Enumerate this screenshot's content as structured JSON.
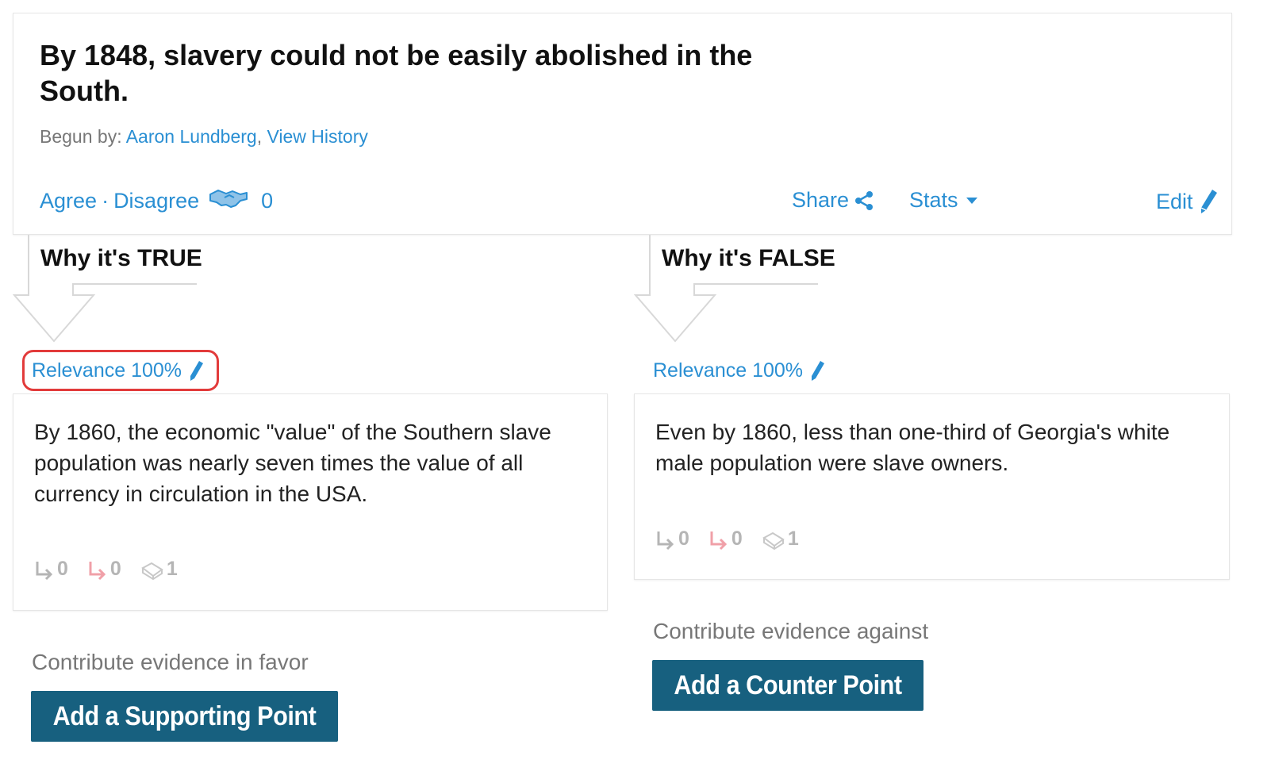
{
  "claim": {
    "title": "By 1848, slavery could not be easily abolished in the South.",
    "begun_by_label": "Begun by:",
    "author": "Aaron Lundberg",
    "separator": ",",
    "view_history": "View History",
    "agree": "Agree",
    "dot": "·",
    "disagree": "Disagree",
    "agree_count": "0",
    "share": "Share",
    "stats": "Stats",
    "edit": "Edit"
  },
  "columns": {
    "true": {
      "heading": "Why it's TRUE",
      "relevance": "Relevance 100%",
      "point_text": "By 1860, the economic \"value\" of the Southern slave population was nearly seven times the value of all currency in circulation in the USA.",
      "supporting_count": "0",
      "counter_count": "0",
      "sources_count": "1",
      "contribute": "Contribute evidence in favor",
      "button": "Add a Supporting Point"
    },
    "false": {
      "heading": "Why it's FALSE",
      "relevance": "Relevance 100%",
      "point_text": "Even by 1860, less than one-third of Georgia's white male population were slave owners.",
      "supporting_count": "0",
      "counter_count": "0",
      "sources_count": "1",
      "contribute": "Contribute evidence against",
      "button": "Add a Counter Point"
    }
  },
  "colors": {
    "link": "#2a8fd3",
    "button": "#17607f",
    "highlight": "#e23b3b",
    "counter_icon_red": "#f0a0a8",
    "muted": "#b5b5b5"
  },
  "icons": {
    "handshake": "handshake-icon",
    "share": "share-icon",
    "stats": "caret-down-icon",
    "edit": "pencil-icon",
    "supporting": "reply-arrow-icon",
    "counter": "reply-arrow-icon",
    "sources": "book-icon"
  }
}
